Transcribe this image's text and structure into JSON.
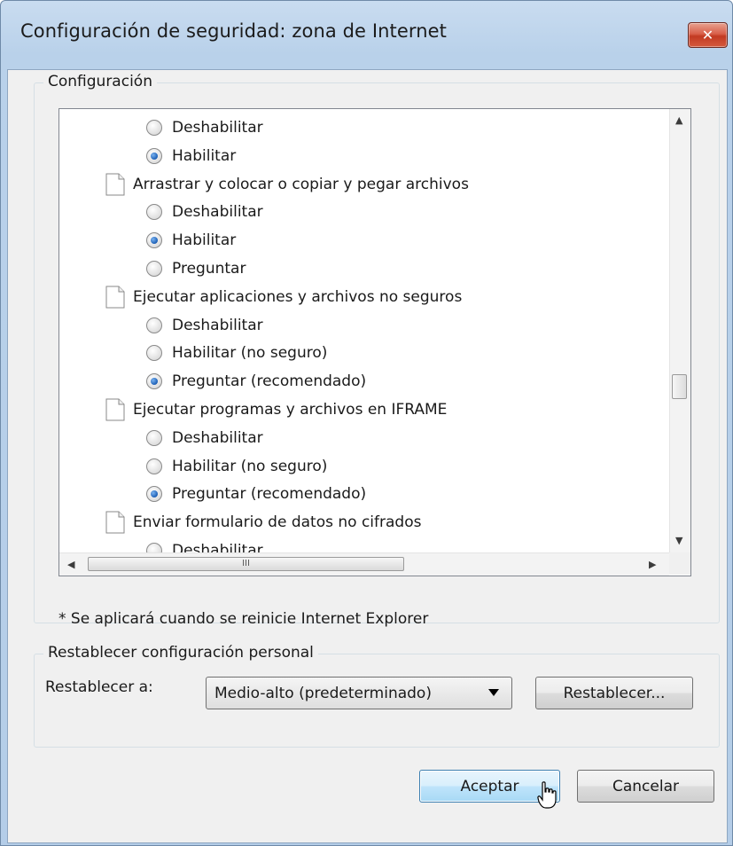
{
  "window": {
    "title": "Configuración de seguridad: zona de Internet",
    "close_glyph": "✕"
  },
  "settings_group": {
    "legend": "Configuración"
  },
  "settings_list": [
    {
      "kind": "option",
      "label": "Deshabilitar",
      "checked": false
    },
    {
      "kind": "option",
      "label": "Habilitar",
      "checked": true
    },
    {
      "kind": "header",
      "label": "Arrastrar y colocar o copiar y pegar archivos"
    },
    {
      "kind": "option",
      "label": "Deshabilitar",
      "checked": false
    },
    {
      "kind": "option",
      "label": "Habilitar",
      "checked": true
    },
    {
      "kind": "option",
      "label": "Preguntar",
      "checked": false
    },
    {
      "kind": "header",
      "label": "Ejecutar aplicaciones y archivos no seguros"
    },
    {
      "kind": "option",
      "label": "Deshabilitar",
      "checked": false
    },
    {
      "kind": "option",
      "label": "Habilitar (no seguro)",
      "checked": false
    },
    {
      "kind": "option",
      "label": "Preguntar (recomendado)",
      "checked": true
    },
    {
      "kind": "header",
      "label": "Ejecutar programas y archivos en IFRAME"
    },
    {
      "kind": "option",
      "label": "Deshabilitar",
      "checked": false
    },
    {
      "kind": "option",
      "label": "Habilitar (no seguro)",
      "checked": false
    },
    {
      "kind": "option",
      "label": "Preguntar (recomendado)",
      "checked": true
    },
    {
      "kind": "header",
      "label": "Enviar formulario de datos no cifrados"
    },
    {
      "kind": "option",
      "label": "Deshabilitar",
      "checked": false
    }
  ],
  "scrollbars": {
    "thumb_grip": "III"
  },
  "footnote": "* Se aplicará cuando se reinicie Internet Explorer",
  "reset_group": {
    "legend": "Restablecer configuración personal",
    "reset_to_label": "Restablecer a:",
    "selected_level": "Medio-alto (predeterminado)",
    "reset_button": "Restablecer..."
  },
  "buttons": {
    "ok": "Aceptar",
    "cancel": "Cancelar"
  }
}
